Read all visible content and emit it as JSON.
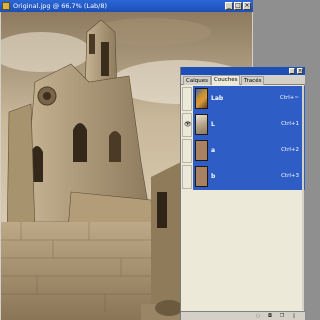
{
  "document": {
    "title": "Original.jpg @ 66,7% (Lab/8)",
    "controls": [
      "_",
      "□",
      "×"
    ]
  },
  "layers_panel": {
    "tabs": [
      {
        "label": "Calques",
        "active": false
      },
      {
        "label": "Couches",
        "active": true
      },
      {
        "label": "Tracés",
        "active": false
      }
    ],
    "menu_arrow": "▸",
    "channels": [
      {
        "name": "Lab",
        "shortcut": "Ctrl+~",
        "visible": false,
        "selected": true,
        "thumb": "lab"
      },
      {
        "name": "L",
        "shortcut": "Ctrl+1",
        "visible": true,
        "selected": true,
        "thumb": "l"
      },
      {
        "name": "a",
        "shortcut": "Ctrl+2",
        "visible": false,
        "selected": true,
        "thumb": "flat"
      },
      {
        "name": "b",
        "shortcut": "Ctrl+3",
        "visible": false,
        "selected": true,
        "thumb": "flat"
      }
    ],
    "bottom_icons": [
      "load-selection-icon",
      "save-selection-icon",
      "new-channel-icon",
      "delete-channel-icon"
    ]
  },
  "colors": {
    "title_bar": "#1d4fb6",
    "selection": "#2e5ec5",
    "sepia": "#b9a27e"
  }
}
